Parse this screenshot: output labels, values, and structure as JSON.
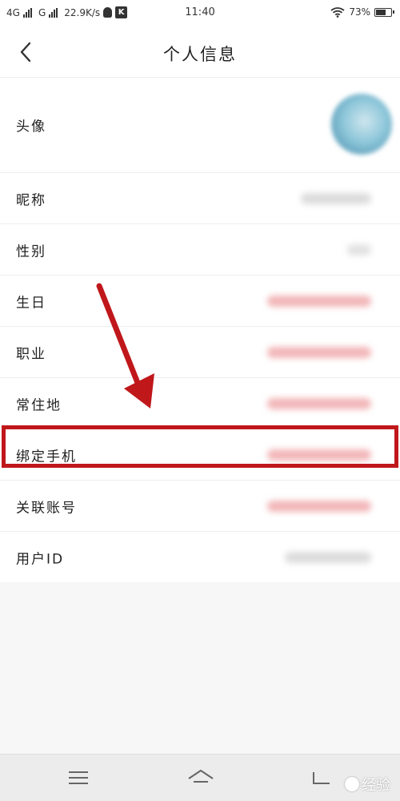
{
  "status_bar": {
    "network1": "4G",
    "network2": "G",
    "speed": "22.9K/s",
    "time": "11:40",
    "battery": "73%",
    "battery_level": 0.73
  },
  "header": {
    "title": "个人信息",
    "back_icon": "chevron-left-icon"
  },
  "rows": [
    {
      "label": "头像"
    },
    {
      "label": "昵称"
    },
    {
      "label": "性别"
    },
    {
      "label": "生日"
    },
    {
      "label": "职业"
    },
    {
      "label": "常住地"
    },
    {
      "label": "绑定手机"
    },
    {
      "label": "关联账号"
    },
    {
      "label": "用户ID"
    }
  ],
  "colors": {
    "annotation_red": "#c0171b",
    "blurred_red": "#f2b6b8",
    "blurred_gray": "#dcdcdc"
  },
  "bottom_nav": {
    "menu_icon": "menu-icon",
    "home_icon": "home-icon",
    "back_icon": "back-icon"
  },
  "watermark": {
    "text": "经验"
  }
}
